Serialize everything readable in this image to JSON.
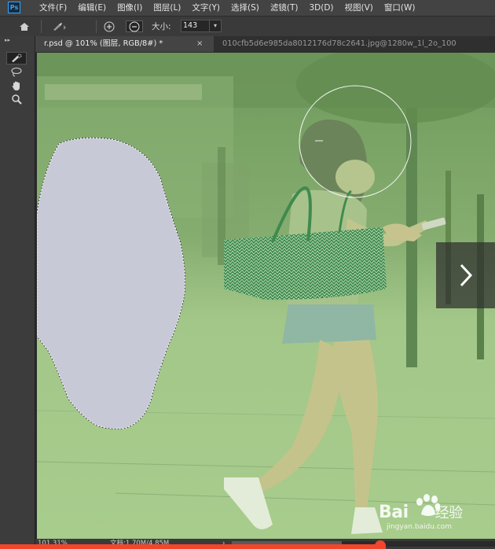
{
  "app": {
    "logo_text": "Ps",
    "brand_color": "#31a8ff"
  },
  "menubar": {
    "items": [
      "文件(F)",
      "编辑(E)",
      "图像(I)",
      "图层(L)",
      "文字(Y)",
      "选择(S)",
      "滤镜(T)",
      "3D(D)",
      "视图(V)",
      "窗口(W)"
    ]
  },
  "options": {
    "size_label": "大小:",
    "size_value": "143"
  },
  "tabs": {
    "active": "r.psd @ 101% (图层, RGB/8#) *",
    "active_close": "×",
    "inactive": "010cfb5d6e985da8012176d78c2641.jpg@1280w_1l_2o_100"
  },
  "toolbar": {
    "collapse": "▸▸",
    "tools": [
      "quick-selection",
      "lasso",
      "hand",
      "zoom"
    ]
  },
  "status": {
    "zoom": "101.31%",
    "doc": "文档:1.70M/4.85M",
    "arrow": "›"
  },
  "overlay": {
    "mask_color": "#a8d98a",
    "selection_color": "#ffffff"
  },
  "watermark": {
    "main": "Bai",
    "jing": "经验",
    "sub": "jingyan.baidu.com"
  },
  "next_button": {
    "icon": "chevron-right-icon"
  }
}
